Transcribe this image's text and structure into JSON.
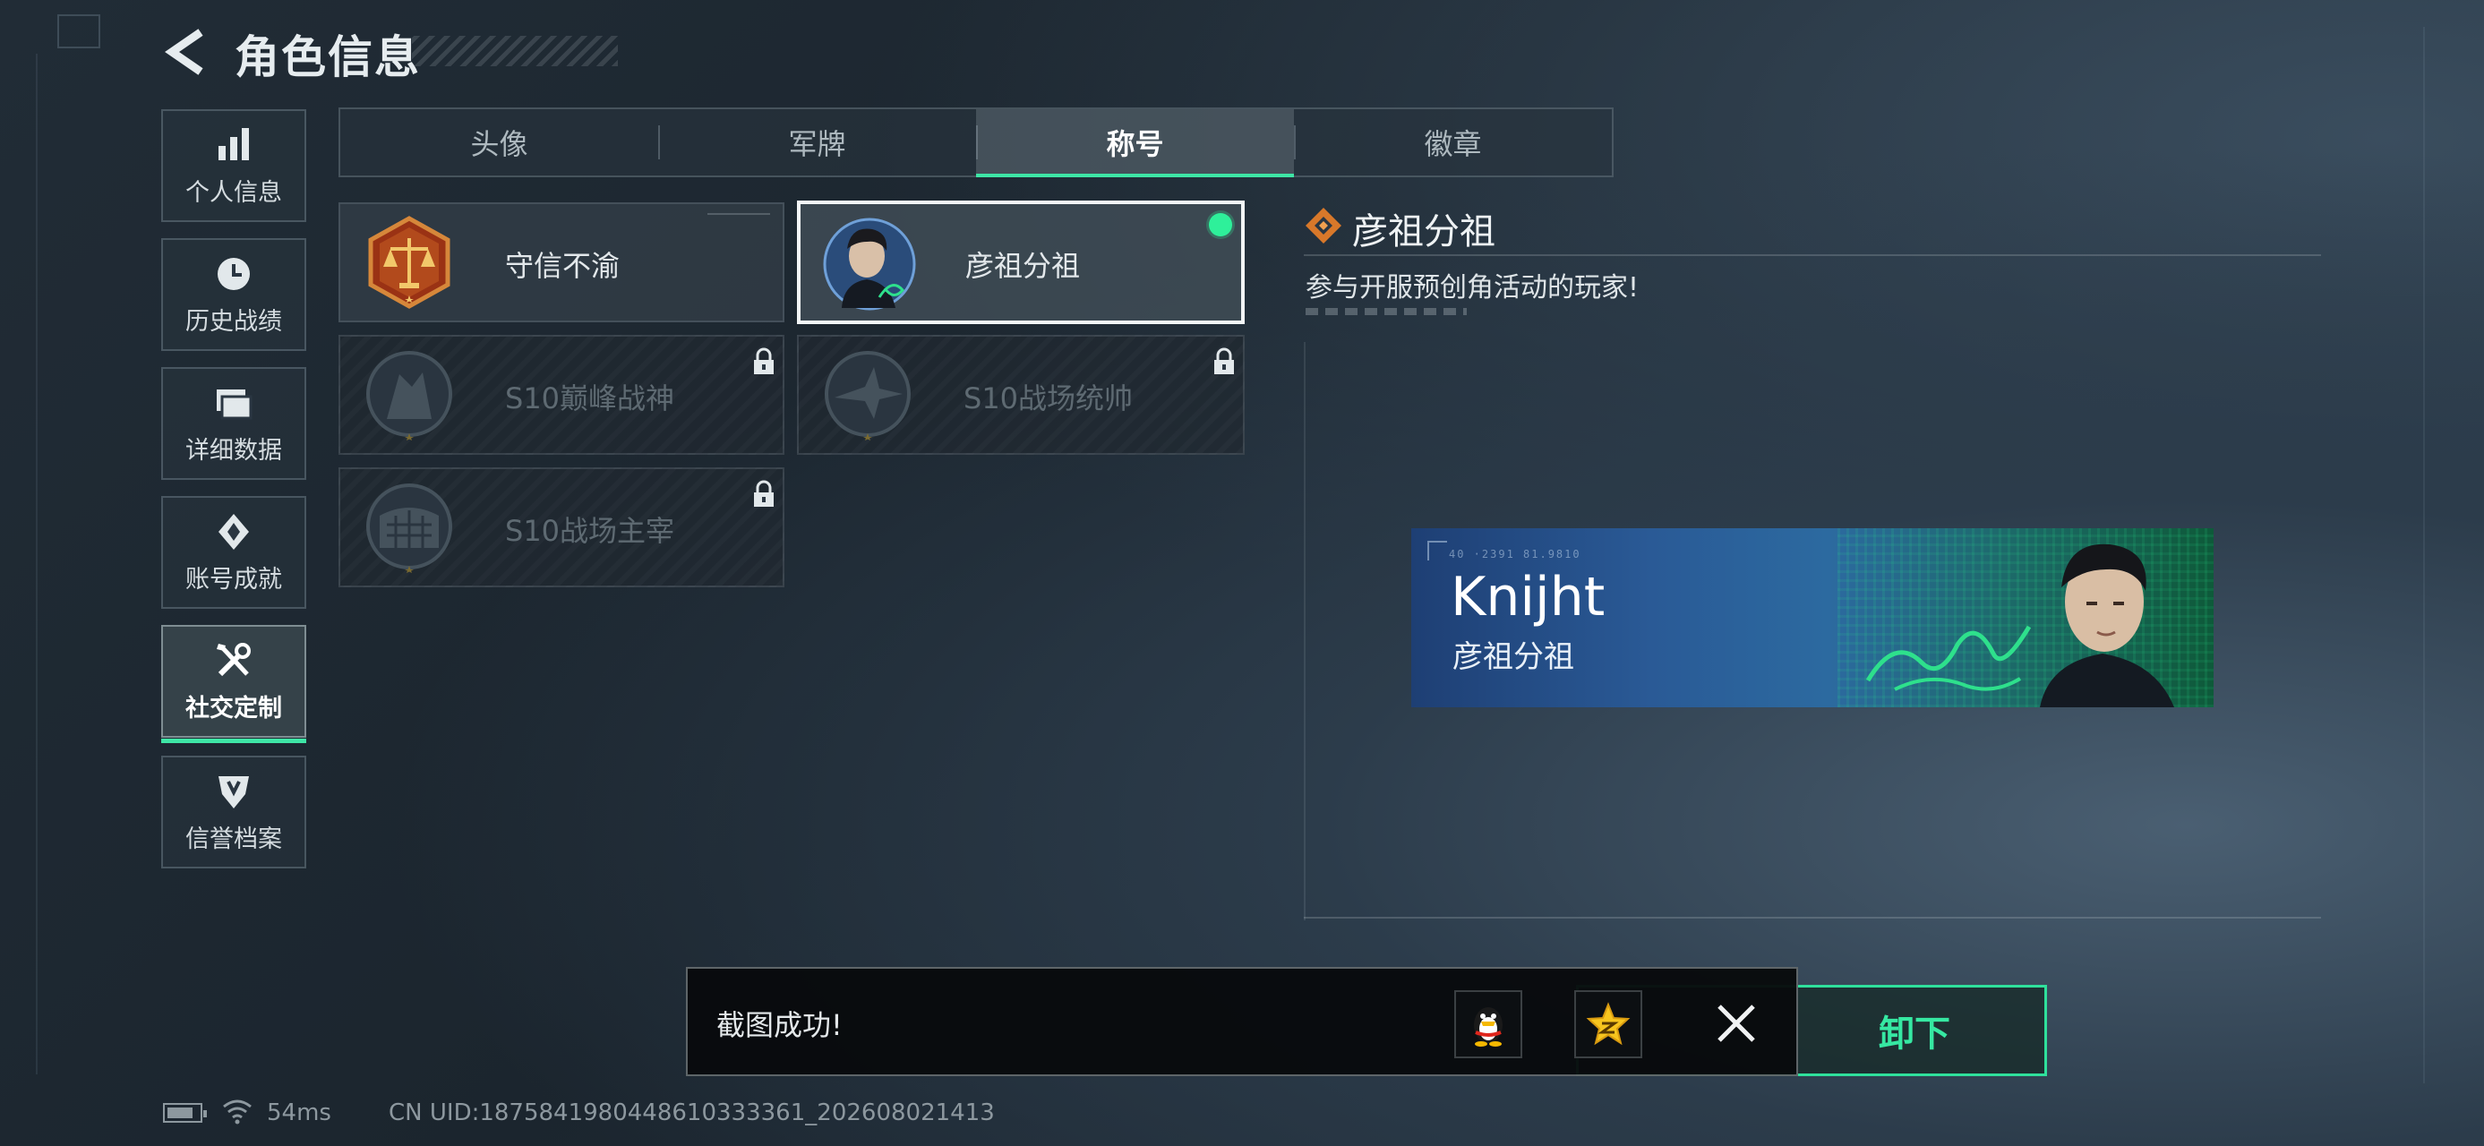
{
  "header": {
    "title": "角色信息",
    "back_icon": "chevron-left-icon"
  },
  "sidebar": {
    "items": [
      {
        "label": "个人信息",
        "icon": "bar-chart-icon",
        "active": false
      },
      {
        "label": "历史战绩",
        "icon": "clock-icon",
        "active": false
      },
      {
        "label": "详细数据",
        "icon": "folder-icon",
        "active": false
      },
      {
        "label": "账号成就",
        "icon": "achievement-icon",
        "active": false
      },
      {
        "label": "社交定制",
        "icon": "tools-icon",
        "active": true
      },
      {
        "label": "信誉档案",
        "icon": "shield-icon",
        "active": false
      }
    ]
  },
  "tabs": [
    {
      "label": "头像",
      "active": false
    },
    {
      "label": "军牌",
      "active": false
    },
    {
      "label": "称号",
      "active": true
    },
    {
      "label": "徽章",
      "active": false
    }
  ],
  "titles": [
    {
      "name": "守信不渝",
      "locked": false,
      "selected": false,
      "equipped": false,
      "icon": "justice-scale-emblem-icon"
    },
    {
      "name": "彦祖分祖",
      "locked": false,
      "selected": true,
      "equipped": true,
      "icon": "portrait-emblem-icon"
    },
    {
      "name": "S10巅峰战神",
      "locked": true,
      "selected": false,
      "equipped": false,
      "icon": "warrior-emblem-icon"
    },
    {
      "name": "S10战场统帅",
      "locked": true,
      "selected": false,
      "equipped": false,
      "icon": "aircraft-emblem-icon"
    },
    {
      "name": "S10战场主宰",
      "locked": true,
      "selected": false,
      "equipped": false,
      "icon": "colosseum-emblem-icon"
    }
  ],
  "detail": {
    "title": "彦祖分祖",
    "description": "参与开服预创角活动的玩家!",
    "icon": "diamond-rank-icon"
  },
  "banner": {
    "code_line": "40 ·2391  81.9810",
    "player_name": "Knijht",
    "title": "彦祖分祖"
  },
  "equip_button": {
    "label": "卸下"
  },
  "toast": {
    "message": "截图成功!",
    "share_buttons": [
      "qq-penguin-icon",
      "qzone-star-icon"
    ],
    "close_icon": "close-icon"
  },
  "status_bar": {
    "ping": "54ms",
    "uid": "CN UID:1875841980448610333361_202608021413"
  },
  "colors": {
    "accent": "#3ee6a6",
    "equipped_dot": "#2ef09a",
    "banner_blue": "#2a5a96",
    "banner_green": "#0e5a3a"
  }
}
